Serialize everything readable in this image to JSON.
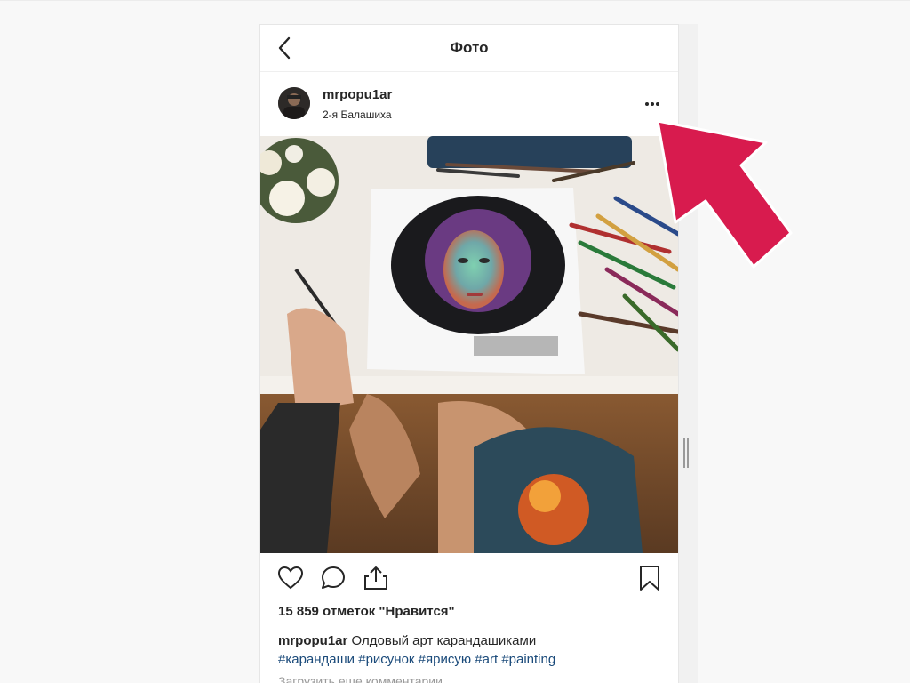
{
  "header": {
    "title": "Фото"
  },
  "post": {
    "username": "mrpopu1ar",
    "location": "2-я Балашиха",
    "likes": "15 859 отметок \"Нравится\"",
    "caption_user": "mrpopu1ar",
    "caption_text": "Олдовый арт карандашиками",
    "hashtags": [
      "#карандаши",
      "#рисунок",
      "#ярисую",
      "#art",
      "#painting"
    ],
    "load_more": "Загрузить еще комментарии"
  },
  "icons": {
    "back": "chevron-left-icon",
    "more": "more-options-icon",
    "like": "heart-icon",
    "comment": "comment-icon",
    "share": "share-icon",
    "save": "bookmark-icon"
  },
  "colors": {
    "accent_arrow": "#d81b4e",
    "link": "#1a4a7a",
    "text": "#262626",
    "muted": "#999999"
  }
}
